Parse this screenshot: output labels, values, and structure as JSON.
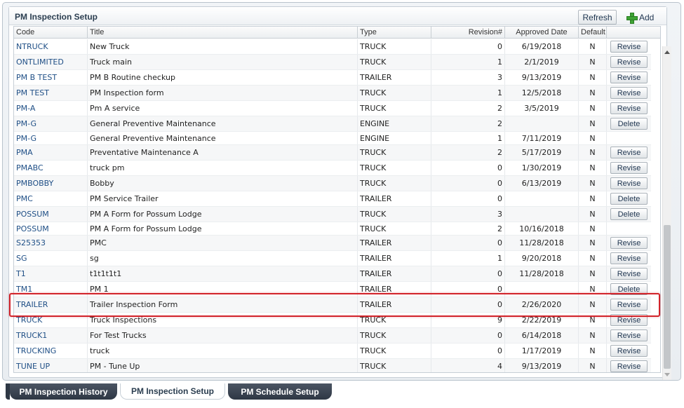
{
  "panel": {
    "title": "PM Inspection Setup",
    "refresh_label": "Refresh",
    "add_label": "Add"
  },
  "columns": [
    "Code",
    "Title",
    "Type",
    "Revision#",
    "Approved Date",
    "Default"
  ],
  "rows": [
    {
      "code": "NTRUCK",
      "title": "New Truck",
      "type": "TRUCK",
      "revision": "0",
      "approved": "6/19/2018",
      "default": "N",
      "action": "Revise"
    },
    {
      "code": "ONTLIMITED",
      "title": "Truck main",
      "type": "TRUCK",
      "revision": "1",
      "approved": "2/1/2019",
      "default": "N",
      "action": "Revise"
    },
    {
      "code": "PM B TEST",
      "title": "PM B Routine checkup",
      "type": "TRAILER",
      "revision": "3",
      "approved": "9/13/2019",
      "default": "N",
      "action": "Revise"
    },
    {
      "code": "PM TEST",
      "title": "PM Inspection form",
      "type": "TRUCK",
      "revision": "1",
      "approved": "12/5/2018",
      "default": "N",
      "action": "Revise"
    },
    {
      "code": "PM-A",
      "title": "Pm A service",
      "type": "TRUCK",
      "revision": "2",
      "approved": "3/5/2019",
      "default": "N",
      "action": "Revise"
    },
    {
      "code": "PM-G",
      "title": "General Preventive Maintenance",
      "type": "ENGINE",
      "revision": "2",
      "approved": "",
      "default": "N",
      "action": "Delete"
    },
    {
      "code": "PM-G",
      "title": "General Preventive Maintenance",
      "type": "ENGINE",
      "revision": "1",
      "approved": "7/11/2019",
      "default": "N",
      "action": ""
    },
    {
      "code": "PMA",
      "title": "Preventative Maintenance A",
      "type": "TRUCK",
      "revision": "2",
      "approved": "5/17/2019",
      "default": "N",
      "action": "Revise"
    },
    {
      "code": "PMABC",
      "title": "truck pm",
      "type": "TRUCK",
      "revision": "0",
      "approved": "1/30/2019",
      "default": "N",
      "action": "Revise"
    },
    {
      "code": "PMBOBBY",
      "title": "Bobby",
      "type": "TRUCK",
      "revision": "0",
      "approved": "6/13/2019",
      "default": "N",
      "action": "Revise"
    },
    {
      "code": "PMC",
      "title": "PM Service Trailer",
      "type": "TRAILER",
      "revision": "0",
      "approved": "",
      "default": "N",
      "action": "Delete"
    },
    {
      "code": "POSSUM",
      "title": "PM A Form for Possum Lodge",
      "type": "TRUCK",
      "revision": "3",
      "approved": "",
      "default": "N",
      "action": "Delete"
    },
    {
      "code": "POSSUM",
      "title": "PM A Form for Possum Lodge",
      "type": "TRUCK",
      "revision": "2",
      "approved": "10/16/2018",
      "default": "N",
      "action": ""
    },
    {
      "code": "S25353",
      "title": "PMC",
      "type": "TRAILER",
      "revision": "0",
      "approved": "11/28/2018",
      "default": "N",
      "action": "Revise"
    },
    {
      "code": "SG",
      "title": "sg",
      "type": "TRAILER",
      "revision": "1",
      "approved": "9/20/2018",
      "default": "N",
      "action": "Revise"
    },
    {
      "code": "T1",
      "title": "t1t1t1t1",
      "type": "TRAILER",
      "revision": "0",
      "approved": "11/28/2018",
      "default": "N",
      "action": "Revise"
    },
    {
      "code": "TM1",
      "title": "PM 1",
      "type": "TRAILER",
      "revision": "0",
      "approved": "",
      "default": "N",
      "action": "Delete"
    },
    {
      "code": "TRAILER",
      "title": "Trailer Inspection Form",
      "type": "TRAILER",
      "revision": "0",
      "approved": "2/26/2020",
      "default": "N",
      "action": "Revise"
    },
    {
      "code": "TRUCK",
      "title": "Truck Inspections",
      "type": "TRUCK",
      "revision": "9",
      "approved": "2/22/2019",
      "default": "N",
      "action": "Revise"
    },
    {
      "code": "TRUCK1",
      "title": "For Test Trucks",
      "type": "TRUCK",
      "revision": "0",
      "approved": "6/14/2018",
      "default": "N",
      "action": "Revise"
    },
    {
      "code": "TRUCKING",
      "title": "truck",
      "type": "TRUCK",
      "revision": "0",
      "approved": "1/17/2019",
      "default": "N",
      "action": "Revise"
    },
    {
      "code": "TUNE UP",
      "title": "PM - Tune Up",
      "type": "TRUCK",
      "revision": "4",
      "approved": "9/13/2019",
      "default": "N",
      "action": "Revise"
    }
  ],
  "tabs": [
    {
      "label": "PM Inspection History",
      "active": false
    },
    {
      "label": "PM Inspection Setup",
      "active": true
    },
    {
      "label": "PM Schedule Setup",
      "active": false
    }
  ]
}
